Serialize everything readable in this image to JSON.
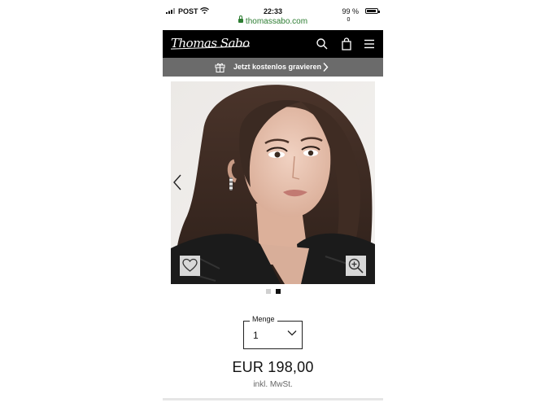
{
  "status_bar": {
    "carrier": "POST",
    "time": "22:33",
    "battery_percent": "99 %"
  },
  "browser": {
    "url": "thomassabo.com",
    "url_color": "#2d7d32"
  },
  "header": {
    "brand": "Thomas Sabo",
    "cart_count": "0",
    "icons": [
      "search-icon",
      "shopping-bag-icon",
      "hamburger-menu-icon"
    ]
  },
  "promo_banner": {
    "text": "Jetzt kostenlos gravieren",
    "icon": "gift-icon"
  },
  "gallery": {
    "slide_count": 2,
    "active_slide": 2,
    "icons": [
      "chevron-left-icon",
      "heart-icon",
      "zoom-in-icon"
    ]
  },
  "quantity": {
    "label": "Menge",
    "value": "1"
  },
  "price": {
    "amount": "EUR 198,00",
    "tax_note": "inkl. MwSt."
  },
  "colors": {
    "header_bg": "#000000",
    "banner_bg": "#6b6b6b"
  }
}
